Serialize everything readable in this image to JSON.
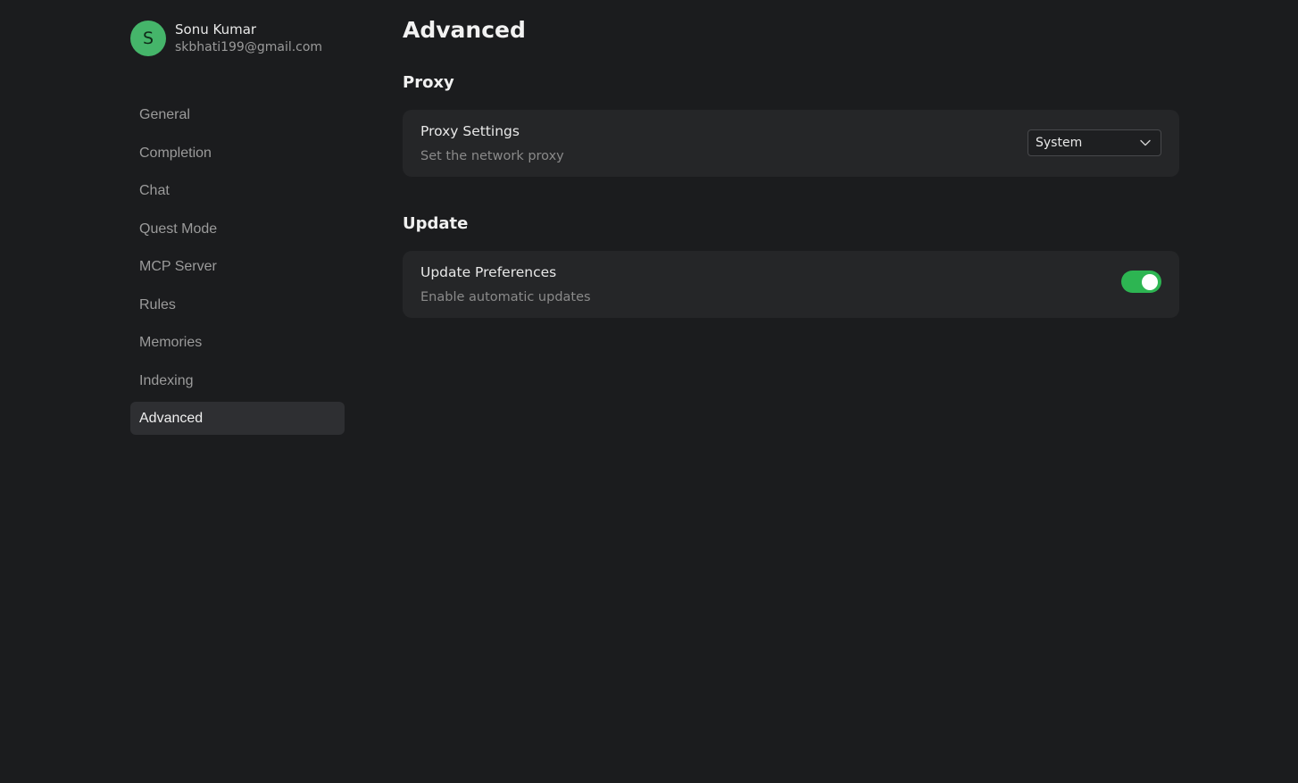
{
  "user": {
    "avatar_initial": "S",
    "name": "Sonu Kumar",
    "email": "skbhati199@gmail.com",
    "avatar_color": "#45b56a"
  },
  "sidebar": {
    "items": [
      {
        "label": "General"
      },
      {
        "label": "Completion"
      },
      {
        "label": "Chat"
      },
      {
        "label": "Quest Mode"
      },
      {
        "label": "MCP Server"
      },
      {
        "label": "Rules"
      },
      {
        "label": "Memories"
      },
      {
        "label": "Indexing"
      },
      {
        "label": "Advanced"
      }
    ],
    "active": "Advanced"
  },
  "main": {
    "title": "Advanced",
    "sections": {
      "proxy": {
        "title": "Proxy",
        "setting": {
          "title": "Proxy Settings",
          "description": "Set the network proxy",
          "selected_value": "System"
        }
      },
      "update": {
        "title": "Update",
        "setting": {
          "title": "Update Preferences",
          "description": "Enable automatic updates",
          "enabled": true
        }
      }
    }
  },
  "colors": {
    "background": "#1b1c1e",
    "card": "#252628",
    "toggle_on": "#2db552",
    "active_nav": "#2e2f32"
  },
  "icons": {
    "dropdown": "chevron-down-icon"
  }
}
